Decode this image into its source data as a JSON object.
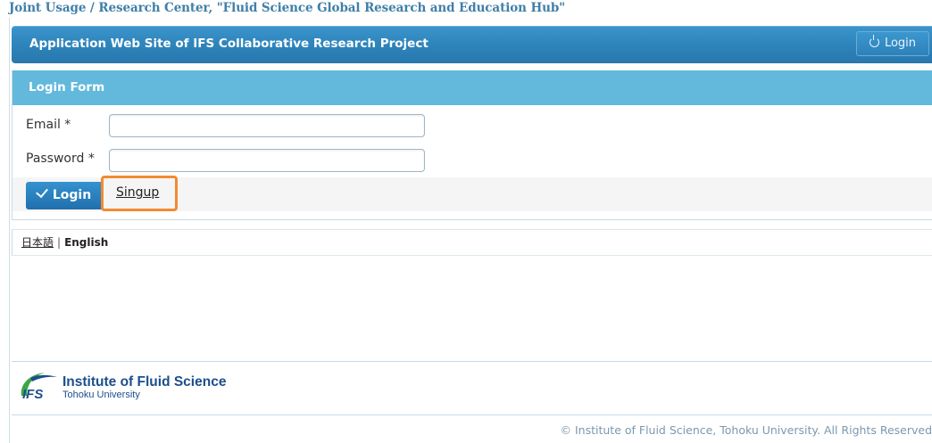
{
  "top_caption": "Joint Usage / Research Center, \"Fluid Science Global Research and Education Hub\"",
  "header": {
    "title": "Application Web Site of IFS Collaborative Research Project",
    "login_label": "Login"
  },
  "login_form": {
    "title": "Login Form",
    "email_label": "Email *",
    "email_value": "",
    "password_label": "Password *",
    "password_value": "",
    "login_button": "Login",
    "signup_link": "Singup"
  },
  "language": {
    "japanese": "日本語",
    "separator": "|",
    "english": "English"
  },
  "footer": {
    "logo_abbrev": "IFS",
    "institute": "Institute of Fluid Science",
    "university": "Tohoku University",
    "copyright": "© Institute of Fluid Science, Tohoku University. All Rights Reserved"
  },
  "colors": {
    "header_blue": "#2f86bd",
    "panel_head": "#62b9dc",
    "highlight_orange": "#f28b30",
    "logo_navy": "#1d4e8b",
    "logo_green": "#3aa64a"
  }
}
